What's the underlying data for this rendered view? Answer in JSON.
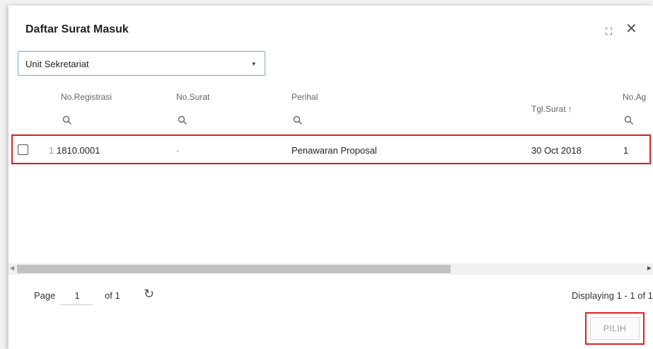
{
  "dialog": {
    "title": "Daftar Surat Masuk",
    "maximize_glyph": "⛶",
    "close_glyph": "✕"
  },
  "filter": {
    "selected": "Unit Sekretariat",
    "arrow": "▾"
  },
  "table": {
    "columns": [
      {
        "label": "No.Registrasi",
        "searchable": true
      },
      {
        "label": "No.Surat",
        "searchable": true
      },
      {
        "label": "Perihal",
        "searchable": true
      },
      {
        "label": "Tgl.Surat ↑",
        "searchable": false,
        "sorted": "asc"
      },
      {
        "label": "No.Ag",
        "searchable": true
      }
    ],
    "rows": [
      {
        "index": "1",
        "no_registrasi": "1810.0001",
        "no_surat": "-",
        "perihal": "Penawaran Proposal",
        "tgl_surat": "30 Oct 2018",
        "no_agenda": "1"
      }
    ]
  },
  "pager": {
    "page_label": "Page",
    "page_value": "1",
    "of_label": "of 1",
    "refresh_glyph": "↻",
    "displaying": "Displaying 1 - 1 of 1"
  },
  "actions": {
    "pilih_label": "PILIH"
  },
  "colors": {
    "highlight": "#e02020",
    "combo_border": "#6aa9e6"
  },
  "icons": {
    "column_search": "search-icon",
    "refresh": "refresh-icon",
    "maximize": "maximize-icon",
    "close": "close-icon"
  }
}
